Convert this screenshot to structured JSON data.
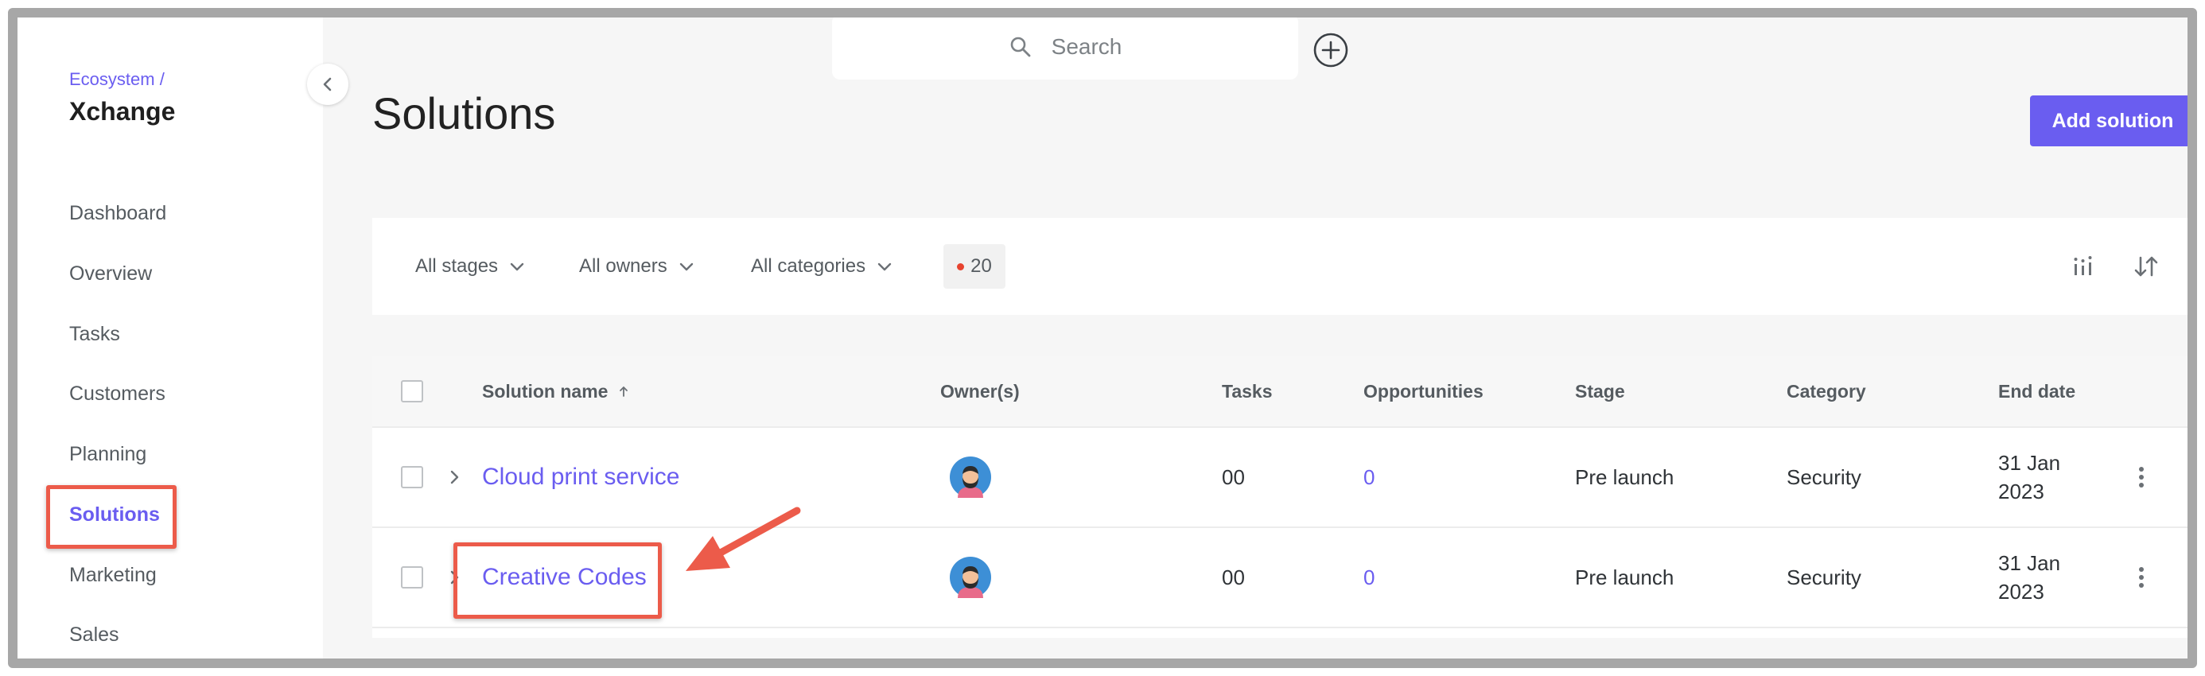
{
  "sidebar": {
    "breadcrumb": "Ecosystem /",
    "app_title": "Xchange",
    "items": [
      {
        "label": "Dashboard"
      },
      {
        "label": "Overview"
      },
      {
        "label": "Tasks"
      },
      {
        "label": "Customers"
      },
      {
        "label": "Planning"
      },
      {
        "label": "Solutions",
        "active": true
      },
      {
        "label": "Marketing"
      },
      {
        "label": "Sales"
      }
    ]
  },
  "topbar": {
    "search_placeholder": "Search"
  },
  "page": {
    "title": "Solutions",
    "add_button": "Add solution"
  },
  "filters": {
    "stages": "All stages",
    "owners": "All owners",
    "categories": "All categories",
    "count": "20"
  },
  "table": {
    "headers": {
      "name": "Solution name",
      "owners": "Owner(s)",
      "tasks": "Tasks",
      "opportunities": "Opportunities",
      "stage": "Stage",
      "category": "Category",
      "end_date": "End date"
    },
    "rows": [
      {
        "name": "Cloud print service",
        "tasks": "00",
        "opportunities": "0",
        "stage": "Pre launch",
        "category": "Security",
        "end_date_line1": "31 Jan",
        "end_date_line2": "2023"
      },
      {
        "name": "Creative Codes",
        "tasks": "00",
        "opportunities": "0",
        "stage": "Pre launch",
        "category": "Security",
        "end_date_line1": "31 Jan",
        "end_date_line2": "2023"
      }
    ]
  },
  "colors": {
    "accent": "#6a5df0",
    "annotation": "#ec5b4a",
    "badge_dot": "#e7432f"
  }
}
